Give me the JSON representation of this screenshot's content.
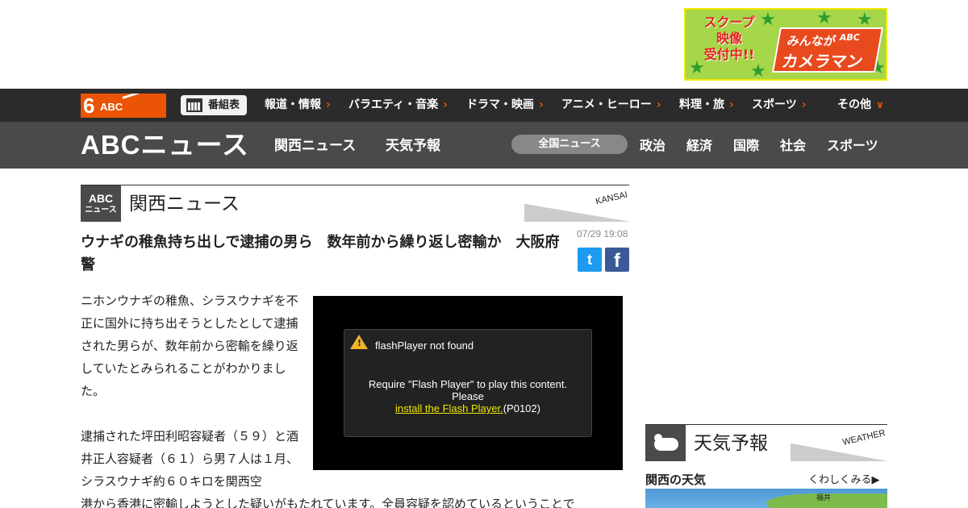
{
  "ad": {
    "scoop": "スクープ",
    "eizo": "映像",
    "uketsuke": "受付中!!",
    "minnaga": "みんなが",
    "abc": "ABC",
    "cameraman": "カメラマン"
  },
  "topnav": {
    "logo_num": "6",
    "logo_abc": "ABC",
    "bangumi": "番組表",
    "items": [
      "報道・情報",
      "バラエティ・音楽",
      "ドラマ・映画",
      "アニメ・ヒーロー",
      "料理・旅",
      "スポーツ",
      "その他"
    ]
  },
  "secnav": {
    "brand": "ABCニュース",
    "kansai": "関西ニュース",
    "tenki": "天気予報",
    "zenkoku": "全国ニュース",
    "categories": [
      "政治",
      "経済",
      "国際",
      "社会",
      "スポーツ"
    ]
  },
  "article": {
    "badge_top": "ABC",
    "badge_bottom": "ニュース",
    "section_title": "関西ニュース",
    "section_tag": "KANSAI",
    "headline": "ウナギの稚魚持ち出しで逮捕の男ら　数年前から繰り返し密輸か　大阪府警",
    "date": "07/29 19:08",
    "share_twitter": "t",
    "share_facebook": "f",
    "para1": "ニホンウナギの稚魚、シラスウナギを不正に国外に持ち出そうとしたとして逮捕された男らが、数年前から密輸を繰り返していたとみられることがわかりました。",
    "para2": "逮捕された坪田利昭容疑者（５９）と酒井正人容疑者（６１）ら男７人は１月、シラスウナギ約６０キロを関西空",
    "para3": "港から香港に密輸しようとした疑いがもたれています。全員容疑を認めているということで"
  },
  "video": {
    "title": "flashPlayer not found",
    "line1": "Require \"Flash Player\" to play this content.",
    "line2": "Please",
    "link": "install the Flash Player.",
    "code": "(P0102)"
  },
  "weather": {
    "section_title": "天気予報",
    "section_tag": "WEATHER",
    "heading": "関西の天気",
    "more": "くわしくみる▶",
    "city": "福井"
  },
  "colors": {
    "accent": "#ea5404",
    "twitter": "#1d9bf0",
    "facebook": "#3b5998"
  }
}
